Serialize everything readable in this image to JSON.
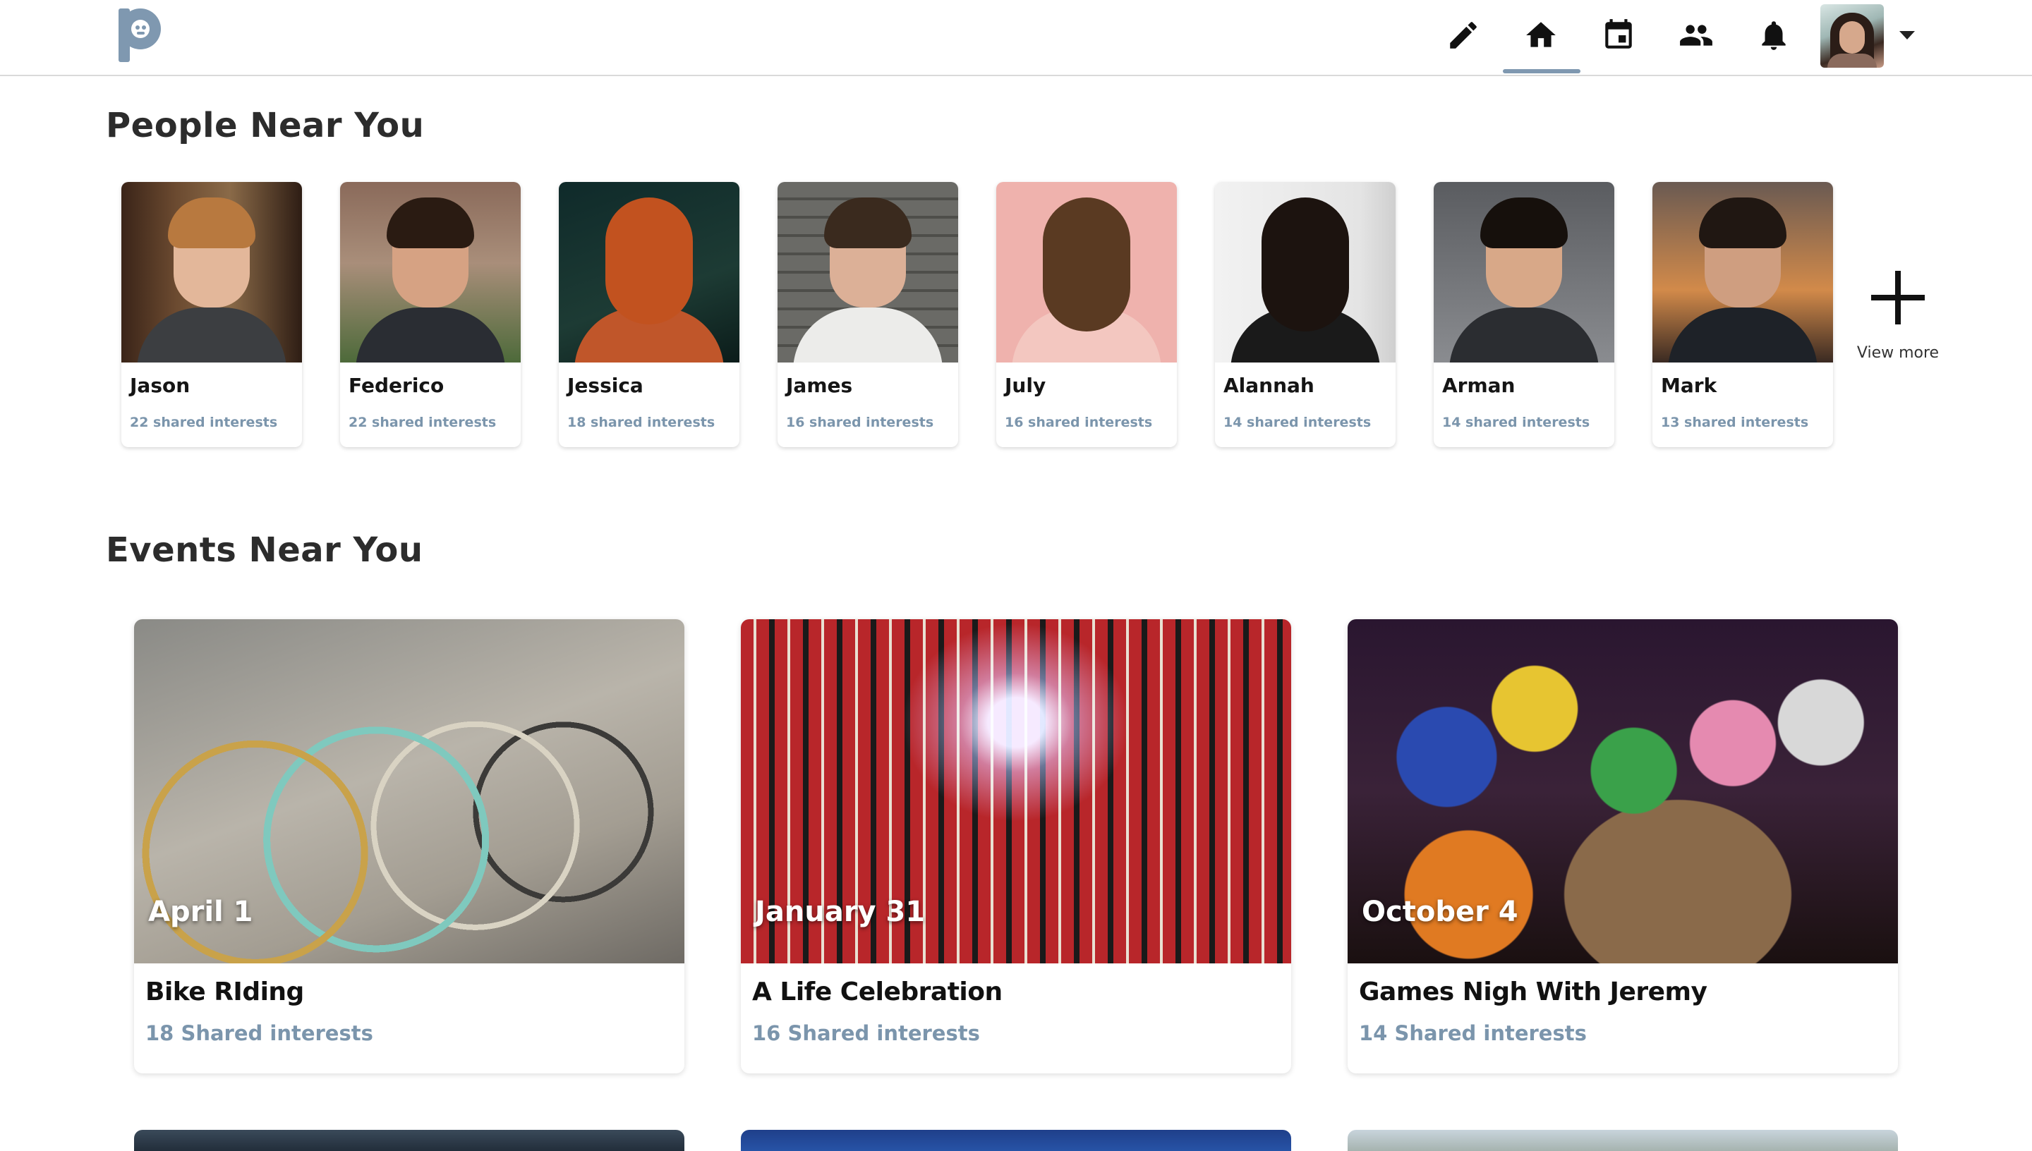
{
  "header": {
    "logo": "app-logo",
    "nav": [
      {
        "icon": "pencil-icon",
        "name": "compose"
      },
      {
        "icon": "home-icon",
        "name": "home",
        "active": true
      },
      {
        "icon": "calendar-icon",
        "name": "events"
      },
      {
        "icon": "people-icon",
        "name": "friends"
      },
      {
        "icon": "bell-icon",
        "name": "notifications"
      }
    ],
    "profile_menu_icon": "chevron-down-icon"
  },
  "people_section": {
    "title": "People Near You",
    "people": [
      {
        "name": "Jason",
        "shared": "22 shared interests"
      },
      {
        "name": "Federico",
        "shared": "22 shared interests"
      },
      {
        "name": "Jessica",
        "shared": "18 shared interests"
      },
      {
        "name": "James",
        "shared": "16 shared interests"
      },
      {
        "name": "July",
        "shared": "16 shared interests"
      },
      {
        "name": "Alannah",
        "shared": "14 shared interests"
      },
      {
        "name": "Arman",
        "shared": "14 shared interests"
      },
      {
        "name": "Mark",
        "shared": "13 shared interests"
      }
    ],
    "view_more": "View more"
  },
  "events_section": {
    "title": "Events Near You",
    "events": [
      {
        "date": "April 1",
        "title": "Bike RIding",
        "shared": "18 Shared interests"
      },
      {
        "date": "January 31",
        "title": "A Life Celebration",
        "shared": "16 Shared interests"
      },
      {
        "date": "October 4",
        "title": "Games Nigh With Jeremy",
        "shared": "14 Shared interests"
      }
    ]
  },
  "colors": {
    "accent": "#7b95ac",
    "active_tab_bar": "#7f98b0",
    "logo": "#7f98b0",
    "heading": "#2c2c2c"
  }
}
